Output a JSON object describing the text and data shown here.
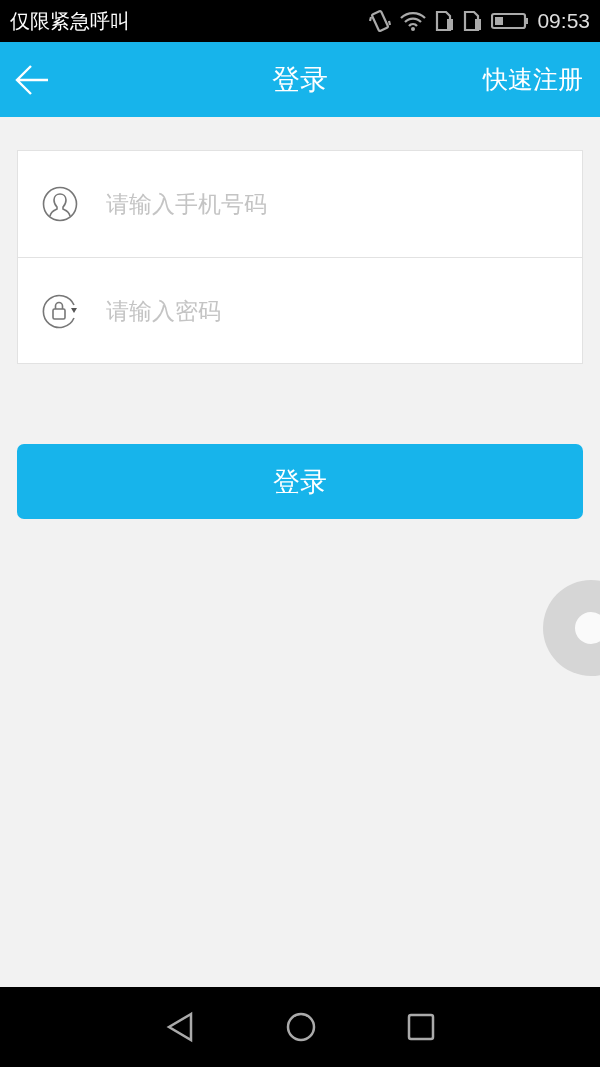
{
  "status_bar": {
    "network_text": "仅限紧急呼叫",
    "time": "09:53"
  },
  "header": {
    "title": "登录",
    "action": "快速注册"
  },
  "fields": [
    {
      "kind": "phone",
      "placeholder": "请输入手机号码"
    },
    {
      "kind": "password",
      "placeholder": "请输入密码"
    }
  ],
  "login_button": {
    "label": "登录"
  }
}
